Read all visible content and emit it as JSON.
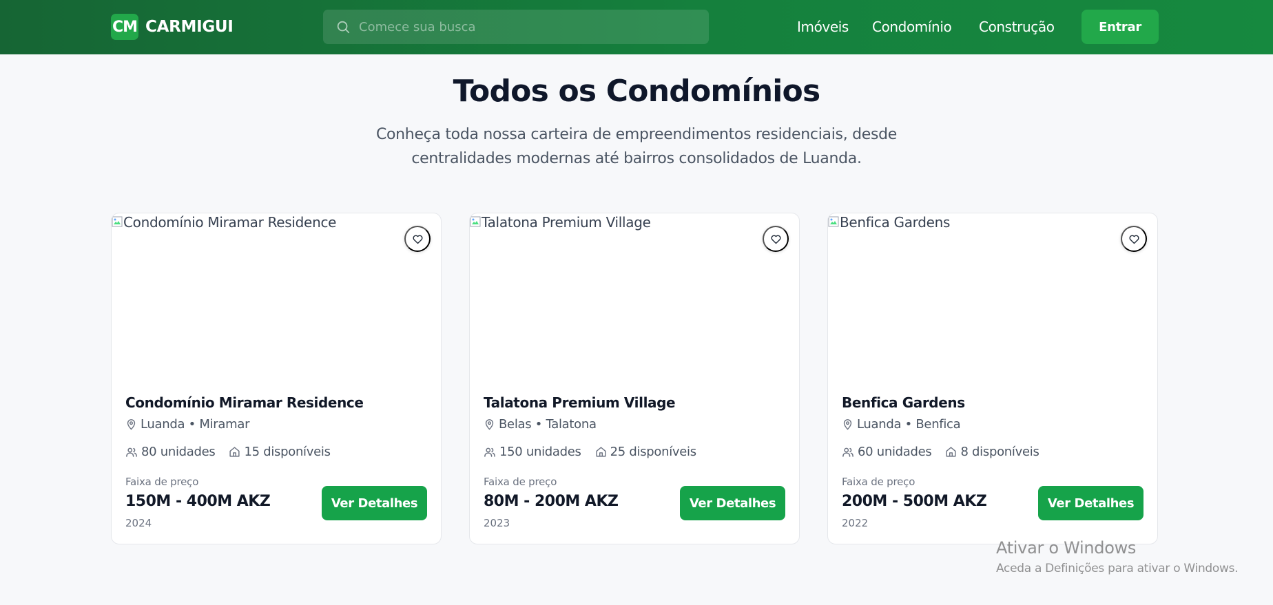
{
  "brand": {
    "mark": "CM",
    "name": "CARMIGUI"
  },
  "search": {
    "placeholder": "Comece sua busca",
    "icon": "search-icon"
  },
  "nav": {
    "links": [
      "Imóveis",
      "Condomínio",
      "Construção"
    ],
    "login_label": "Entrar"
  },
  "colors": {
    "header": "#166534",
    "accent": "#16a34a",
    "brand_mark": "#22a84a"
  },
  "heading": {
    "title": "Todos os Condomínios",
    "subtitle": "Conheça toda nossa carteira de empreendimentos residenciais, desde centralidades modernas até bairros consolidados de Luanda."
  },
  "cards": [
    {
      "image_alt": "Condomínio Miramar Residence",
      "name": "Condomínio Miramar Residence",
      "location": "Luanda • Miramar",
      "units": "80 unidades",
      "available": "15 disponíveis",
      "price_label": "Faixa de preço",
      "price": "150M - 400M AKZ",
      "year": "2024",
      "button": "Ver Detalhes"
    },
    {
      "image_alt": "Talatona Premium Village",
      "name": "Talatona Premium Village",
      "location": "Belas • Talatona",
      "units": "150 unidades",
      "available": "25 disponíveis",
      "price_label": "Faixa de preço",
      "price": "80M - 200M AKZ",
      "year": "2023",
      "button": "Ver Detalhes"
    },
    {
      "image_alt": "Benfica Gardens",
      "name": "Benfica Gardens",
      "location": "Luanda • Benfica",
      "units": "60 unidades",
      "available": "8 disponíveis",
      "price_label": "Faixa de preço",
      "price": "200M - 500M AKZ",
      "year": "2022",
      "button": "Ver Detalhes"
    }
  ],
  "icons": {
    "favorite": "heart-icon",
    "location": "map-pin-icon",
    "units": "users-icon",
    "available": "home-icon",
    "broken_image": "broken-image-icon"
  },
  "watermark": {
    "title": "Ativar o Windows",
    "subtitle": "Aceda a Definições para ativar o Windows."
  }
}
